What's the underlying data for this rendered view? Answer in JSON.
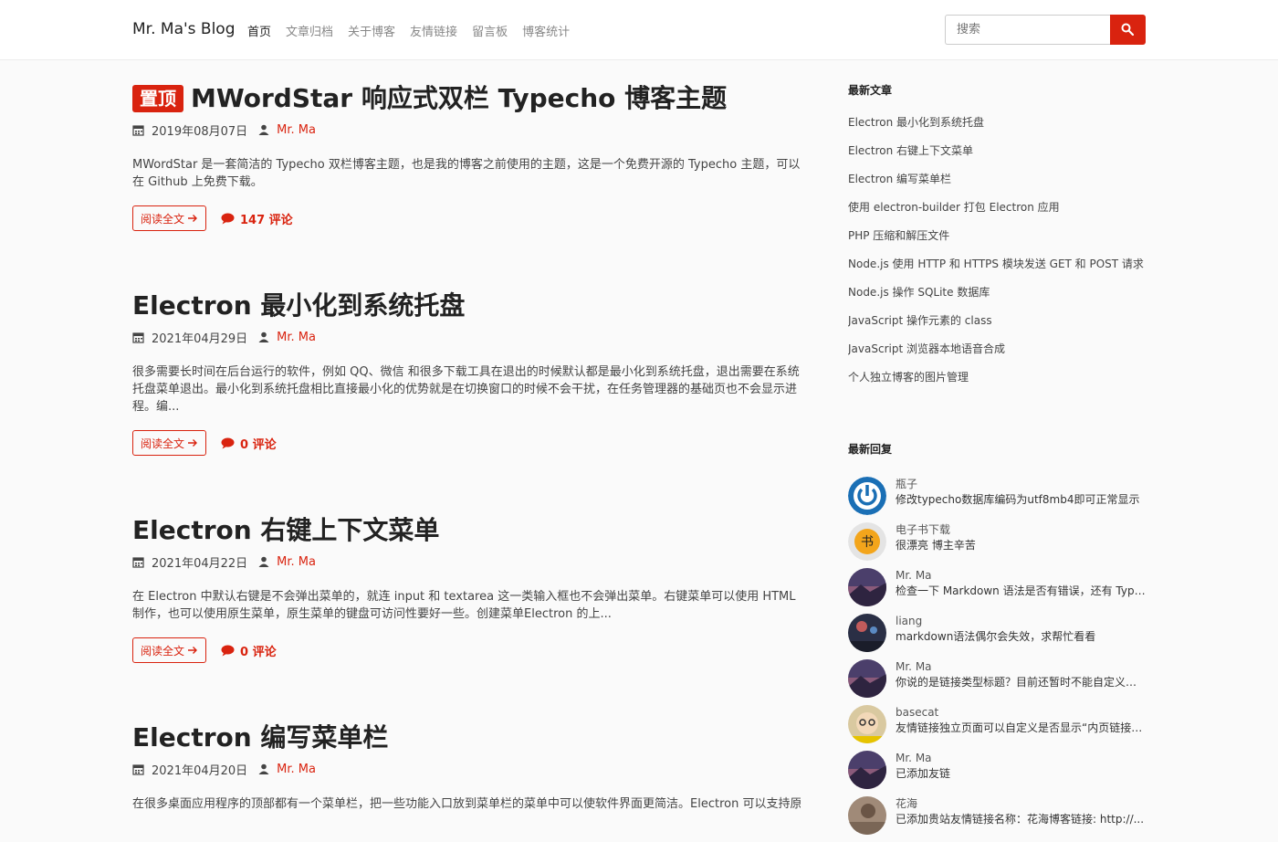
{
  "header": {
    "brand": "Mr. Ma's Blog",
    "nav": [
      "首页",
      "文章归档",
      "关于博客",
      "友情链接",
      "留言板",
      "博客统计"
    ],
    "search_placeholder": "搜索",
    "accent_color": "#d9230f"
  },
  "posts": [
    {
      "sticky_label": "置顶",
      "title": "MWordStar 响应式双栏 Typecho 博客主题",
      "date": "2019年08月07日",
      "author": "Mr. Ma",
      "excerpt": "MWordStar 是一套简洁的 Typecho 双栏博客主题，也是我的博客之前使用的主题，这是一个免费开源的 Typecho 主题，可以在 Github 上免费下载。",
      "read_more": "阅读全文",
      "comments": "147 评论"
    },
    {
      "title": "Electron 最小化到系统托盘",
      "date": "2021年04月29日",
      "author": "Mr. Ma",
      "excerpt": "很多需要长时间在后台运行的软件，例如 QQ、微信 和很多下载工具在退出的时候默认都是最小化到系统托盘，退出需要在系统托盘菜单退出。最小化到系统托盘相比直接最小化的优势就是在切换窗口的时候不会干扰，在任务管理器的基础页也不会显示进程。编...",
      "read_more": "阅读全文",
      "comments": "0 评论"
    },
    {
      "title": "Electron 右键上下文菜单",
      "date": "2021年04月22日",
      "author": "Mr. Ma",
      "excerpt": "在 Electron 中默认右键是不会弹出菜单的，就连 input 和 textarea 这一类输入框也不会弹出菜单。右键菜单可以使用 HTML 制作，也可以使用原生菜单，原生菜单的键盘可访问性要好一些。创建菜单Electron 的上...",
      "read_more": "阅读全文",
      "comments": "0 评论"
    },
    {
      "title": "Electron 编写菜单栏",
      "date": "2021年04月20日",
      "author": "Mr. Ma",
      "excerpt": "在很多桌面应用程序的顶部都有一个菜单栏，把一些功能入口放到菜单栏的菜单中可以使软件界面更简洁。Electron 可以支持原"
    }
  ],
  "sidebar": {
    "recent_title": "最新文章",
    "recent_posts": [
      "Electron 最小化到系统托盘",
      "Electron 右键上下文菜单",
      "Electron 编写菜单栏",
      "使用 electron-builder 打包 Electron 应用",
      "PHP 压缩和解压文件",
      "Node.js 使用 HTTP 和 HTTPS 模块发送 GET 和 POST 请求",
      "Node.js 操作 SQLite 数据库",
      "JavaScript 操作元素的 class",
      "JavaScript 浏览器本地语音合成",
      "个人独立博客的图片管理"
    ],
    "replies_title": "最新回复",
    "replies": [
      {
        "name": "瓶子",
        "message": "修改typecho数据库编码为utf8mb4即可正常显示",
        "avatar": "power"
      },
      {
        "name": "电子书下载",
        "message": "很漂亮 博主辛苦",
        "avatar": "book"
      },
      {
        "name": "Mr. Ma",
        "message": "检查一下 Markdown 语法是否有错误，还有 Type...",
        "avatar": "night"
      },
      {
        "name": "liang",
        "message": "markdown语法偶尔会失效，求帮忙看看",
        "avatar": "firework"
      },
      {
        "name": "Mr. Ma",
        "message": "你说的是链接类型标题？目前还暂时不能自定义，...",
        "avatar": "night"
      },
      {
        "name": "basecat",
        "message": "友情链接独立页面可以自定义是否显示“内页链接”...",
        "avatar": "cartoon"
      },
      {
        "name": "Mr. Ma",
        "message": "已添加友链",
        "avatar": "night"
      },
      {
        "name": "花海",
        "message": "已添加贵站友情链接名称：花海博客链接: http://...",
        "avatar": "photo"
      }
    ]
  }
}
